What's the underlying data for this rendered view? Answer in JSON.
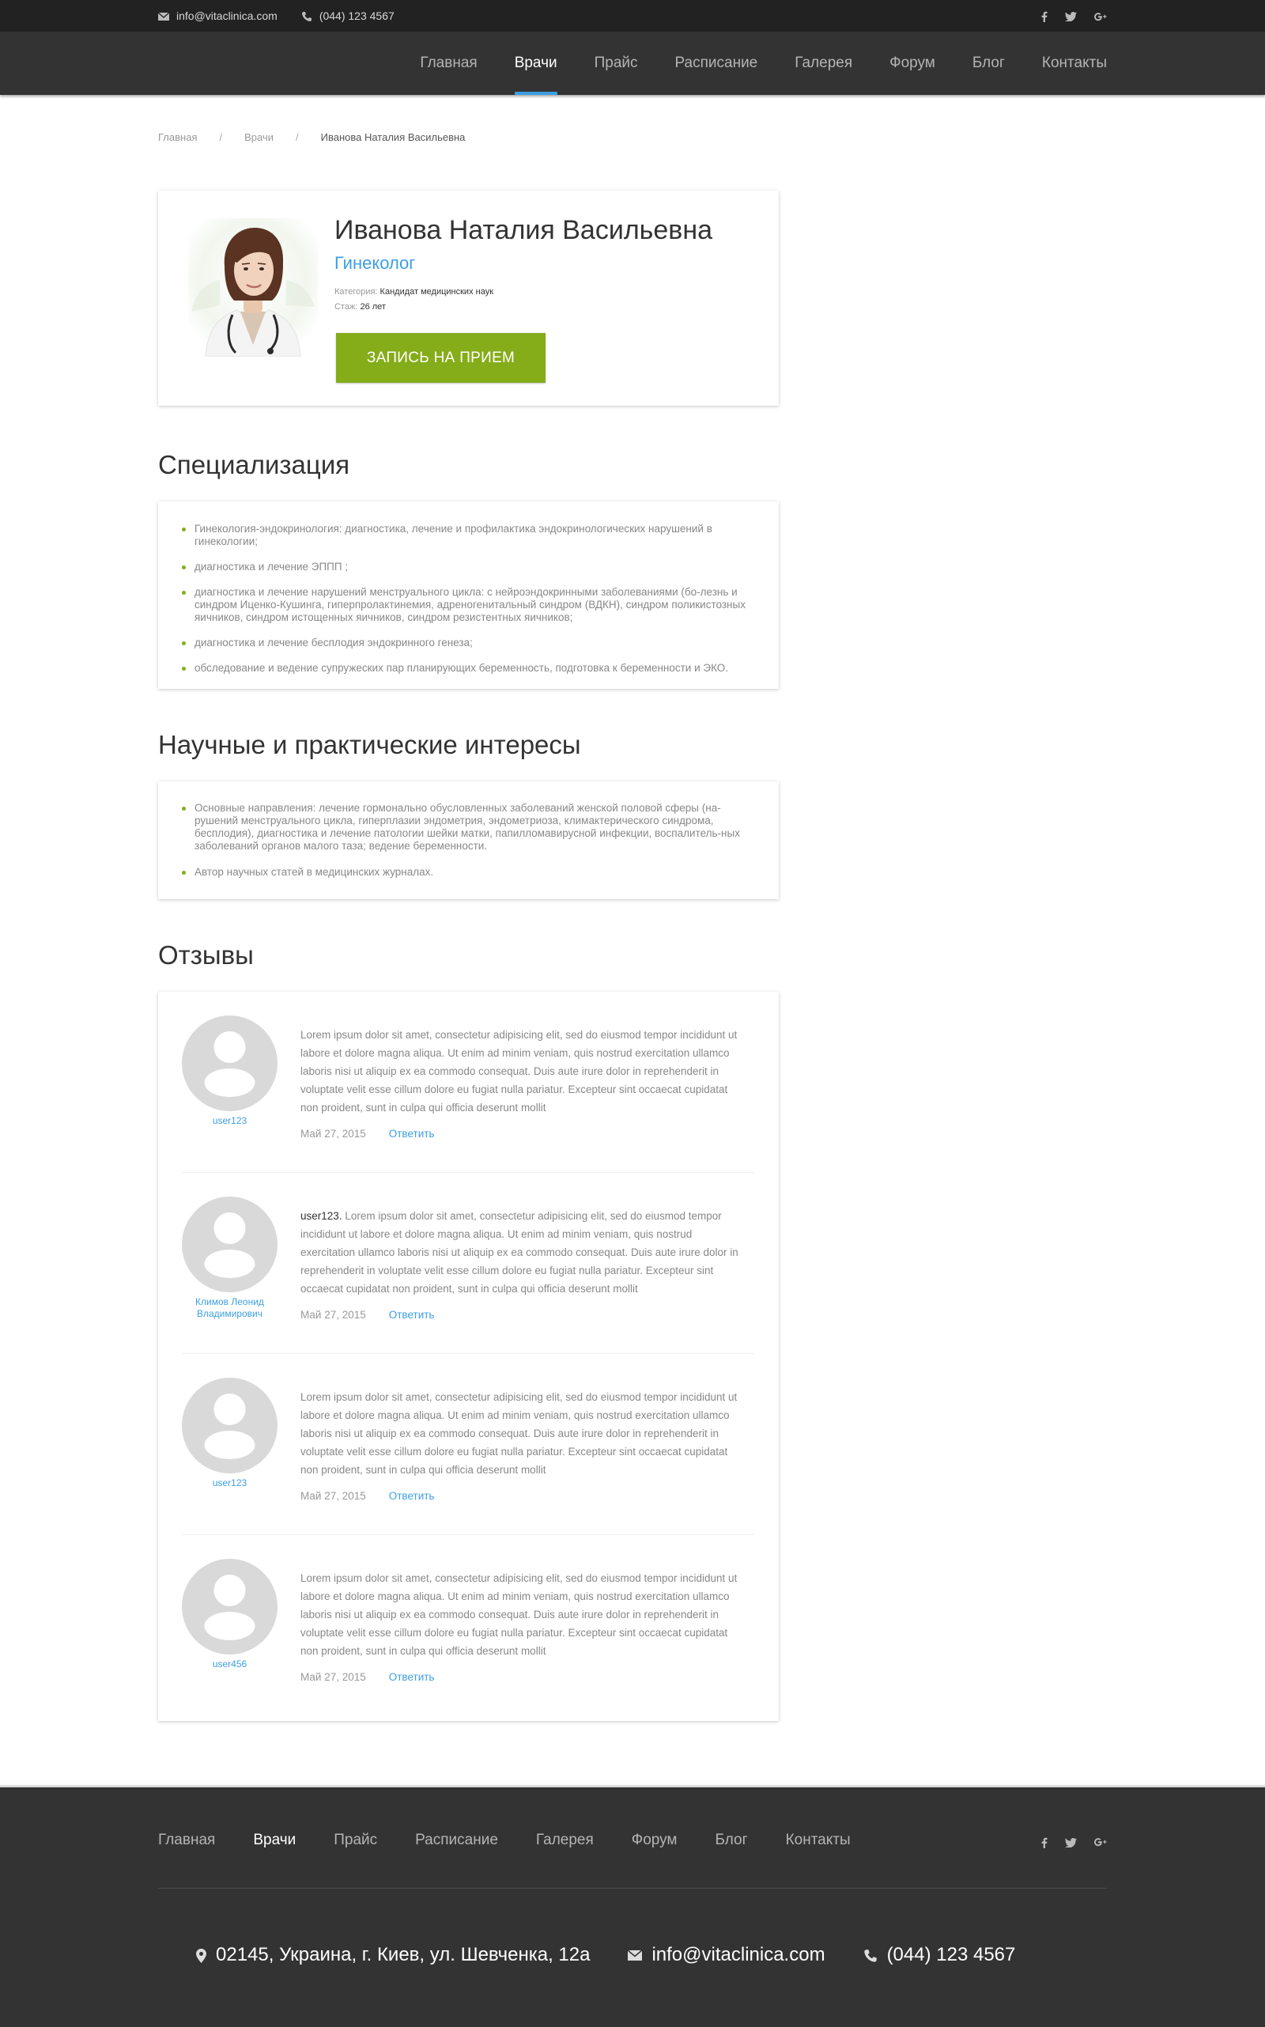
{
  "topbar": {
    "email": "info@vitaclinica.com",
    "phone": "(044) 123 4567",
    "social": [
      "facebook-icon",
      "twitter-icon",
      "google-plus-icon"
    ]
  },
  "nav": {
    "items": [
      {
        "label": "Главная",
        "active": false
      },
      {
        "label": "Врачи",
        "active": true
      },
      {
        "label": "Прайс",
        "active": false
      },
      {
        "label": "Расписание",
        "active": false
      },
      {
        "label": "Галерея",
        "active": false
      },
      {
        "label": "Форум",
        "active": false
      },
      {
        "label": "Блог",
        "active": false
      },
      {
        "label": "Контакты",
        "active": false
      }
    ],
    "accent_color": "#3d9fe0"
  },
  "breadcrumb": {
    "items": [
      "Главная",
      "Врачи"
    ],
    "separator": "/",
    "current": "Иванова Наталия Васильевна"
  },
  "doctor": {
    "name": "Иванова Наталия Васильевна",
    "specialty": "Гинеколог",
    "category_label": "Категория:",
    "category_value": "Кандидат медицинских наук",
    "experience_label": "Стаж:",
    "experience_value": "26 лет",
    "book_button": "ЗАПИСЬ НА ПРИЕМ",
    "button_color": "#85ac19"
  },
  "specialization": {
    "title": "Специализация",
    "items": [
      "Гинекология-эндокринология: диагностика, лечение и профилактика эндокринологических нарушений в гинекологии;",
      "диагностика и лечение ЭППП ;",
      "диагностика и лечение нарушений менструального цикла: с нейроэндокринными заболеваниями (бо-лезнь и синдром Иценко-Кушинга, гиперпролактинемия, адреногенитальный синдром (ВДКН), синдром поликистозных яичников, синдром истощенных яичников, синдром резистентных яичников;",
      "диагностика и лечение бесплодия эндокринного генеза;",
      "обследование и ведение супружеских пар планирующих беременность, подготовка к беременности и ЭКО."
    ]
  },
  "interests": {
    "title": "Научные и практические интересы",
    "items": [
      "Основные направления: лечение гормонально обусловленных заболеваний женской половой сферы (на-рушений менструального цикла, гиперплазии эндометрия, эндометриоза, климактерического синдрома, бесплодия), диагностика и лечение патологии шейки матки, папилломавирусной инфекции, воспалитель-ных заболеваний органов малого таза; ведение беременности.",
      "Автор научных статей в медицинских журналах."
    ]
  },
  "reviews": {
    "title": "Отзывы",
    "reply_label": "Ответить",
    "items": [
      {
        "user": "user123",
        "author_prefix": "",
        "text": "Lorem ipsum dolor sit amet, consectetur adipisicing elit, sed do eiusmod tempor incididunt ut labore et dolore magna aliqua. Ut enim ad minim veniam, quis nostrud exercitation ullamco laboris nisi ut aliquip ex ea commodo consequat. Duis aute irure dolor in reprehenderit in voluptate velit esse cillum dolore eu fugiat nulla pariatur. Excepteur sint occaecat cupidatat non proident, sunt in culpa qui officia deserunt mollit",
        "date": "Май 27, 2015"
      },
      {
        "user": "Климов Леонид Владимирович",
        "author_prefix": "user123.",
        "text": "Lorem ipsum dolor sit amet, consectetur adipisicing elit, sed do eiusmod tempor incididunt ut labore et dolore magna aliqua. Ut enim ad minim veniam, quis nostrud exercitation ullamco laboris nisi ut aliquip ex ea commodo consequat. Duis aute irure dolor in reprehenderit in voluptate velit esse cillum dolore eu fugiat nulla pariatur. Excepteur sint occaecat cupidatat non proident, sunt in culpa qui officia deserunt mollit",
        "date": "Май 27, 2015"
      },
      {
        "user": "user123",
        "author_prefix": "",
        "text": "Lorem ipsum dolor sit amet, consectetur adipisicing elit, sed do eiusmod tempor incididunt ut labore et dolore magna aliqua. Ut enim ad minim veniam, quis nostrud exercitation ullamco laboris nisi ut aliquip ex ea commodo consequat. Duis aute irure dolor in reprehenderit in voluptate velit esse cillum dolore eu fugiat nulla pariatur. Excepteur sint occaecat cupidatat non proident, sunt in culpa qui officia deserunt mollit",
        "date": "Май 27, 2015"
      },
      {
        "user": "user456",
        "author_prefix": "",
        "text": "Lorem ipsum dolor sit amet, consectetur adipisicing elit, sed do eiusmod tempor incididunt ut labore et dolore magna aliqua. Ut enim ad minim veniam, quis nostrud exercitation ullamco laboris nisi ut aliquip ex ea commodo consequat. Duis aute irure dolor in reprehenderit in voluptate velit esse cillum dolore eu fugiat nulla pariatur. Excepteur sint occaecat cupidatat non proident, sunt in culpa qui officia deserunt mollit",
        "date": "Май 27, 2015"
      }
    ]
  },
  "footer": {
    "nav": [
      {
        "label": "Главная",
        "active": false
      },
      {
        "label": "Врачи",
        "active": true
      },
      {
        "label": "Прайс",
        "active": false
      },
      {
        "label": "Расписание",
        "active": false
      },
      {
        "label": "Галерея",
        "active": false
      },
      {
        "label": "Форум",
        "active": false
      },
      {
        "label": "Блог",
        "active": false
      },
      {
        "label": "Контакты",
        "active": false
      }
    ],
    "address": "02145, Украина, г. Киев, ул. Шевченка, 12а",
    "email": "info@vitaclinica.com",
    "phone": "(044) 123 4567"
  }
}
